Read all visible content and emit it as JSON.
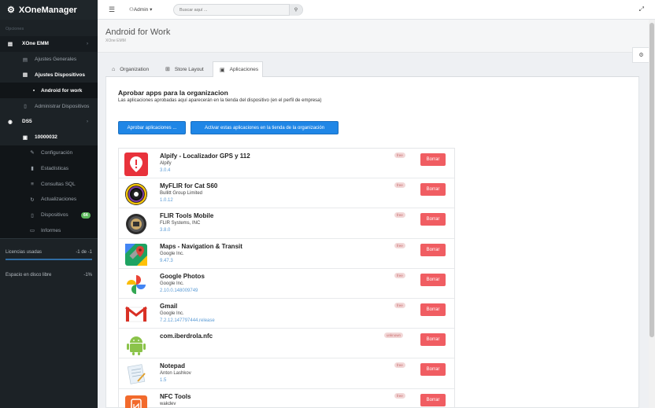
{
  "brand": {
    "title": "XOneManager"
  },
  "sidebar": {
    "section_label": "Opciones",
    "items": [
      {
        "label": "XOne EMM",
        "icon": "server-icon"
      },
      {
        "label": "Ajustes Generales",
        "icon": "list-icon"
      },
      {
        "label": "Ajustes Dispositivos",
        "icon": "list-icon"
      },
      {
        "label": "Android for work",
        "icon": "android-icon"
      },
      {
        "label": "Administrar Dispositivos",
        "icon": "mobile-icon"
      },
      {
        "label": "DS5",
        "icon": "dashboard-icon"
      },
      {
        "label": "10000032",
        "icon": "file-icon"
      },
      {
        "label": "Configuración",
        "icon": "wrench-icon"
      },
      {
        "label": "Estadísticas",
        "icon": "chart-icon"
      },
      {
        "label": "Consultas SQL",
        "icon": "database-icon"
      },
      {
        "label": "Actualizaciones",
        "icon": "refresh-icon"
      },
      {
        "label": "Dispositivos",
        "icon": "mobile-icon",
        "badge": "64"
      },
      {
        "label": "Informes",
        "icon": "report-icon"
      }
    ],
    "stats": [
      {
        "label": "Licencias usadas",
        "value": "-1 de -1"
      },
      {
        "label": "Espacio en disco libre",
        "value": "-1%"
      }
    ]
  },
  "topbar": {
    "user": "Admin",
    "search_placeholder": "Buscar aquí ..."
  },
  "header": {
    "title": "Android for Work",
    "subtitle": "XOne EMM"
  },
  "tabs": [
    {
      "label": "Organization"
    },
    {
      "label": "Store Layout"
    },
    {
      "label": "Aplicaciones"
    }
  ],
  "panel": {
    "title": "Aprobar apps para la organizacion",
    "description": "Las aplicaciones aprobadas aquí aparecerán en la tienda del dispositivo (en el perfil de empresa)",
    "approve_button": "Aprobar aplicaciones ...",
    "activate_button": "Activar estas aplicaciones en la tienda de la organización",
    "delete_label": "Borrar"
  },
  "apps": [
    {
      "name": "Alpify - Localizador GPS y 112",
      "developer": "Alpify",
      "version": "3.0.4",
      "tag": "free",
      "icon": "alpify-icon"
    },
    {
      "name": "MyFLIR for Cat S60",
      "developer": "Bullitt Group Limited",
      "version": "1.0.12",
      "tag": "free",
      "icon": "myflir-icon"
    },
    {
      "name": "FLIR Tools Mobile",
      "developer": "FLIR Systems, INC",
      "version": "3.8.0",
      "tag": "free",
      "icon": "flir-tools-icon"
    },
    {
      "name": "Maps - Navigation & Transit",
      "developer": "Google Inc.",
      "version": "9.47.3",
      "tag": "free",
      "icon": "google-maps-icon"
    },
    {
      "name": "Google Photos",
      "developer": "Google Inc.",
      "version": "2.10.0.148009749",
      "tag": "free",
      "icon": "google-photos-icon"
    },
    {
      "name": "Gmail",
      "developer": "Google Inc.",
      "version": "7.2.12.147797444.release",
      "tag": "free",
      "icon": "gmail-icon"
    },
    {
      "name": "com.iberdrola.nfc",
      "developer": "",
      "version": "",
      "tag": "unknown",
      "icon": "android-icon"
    },
    {
      "name": "Notepad",
      "developer": "Anton Lashkov",
      "version": "1.5",
      "tag": "free",
      "icon": "notepad-icon"
    },
    {
      "name": "NFC Tools",
      "developer": "wakdev",
      "version": "",
      "tag": "free",
      "icon": "nfc-tools-icon"
    }
  ]
}
